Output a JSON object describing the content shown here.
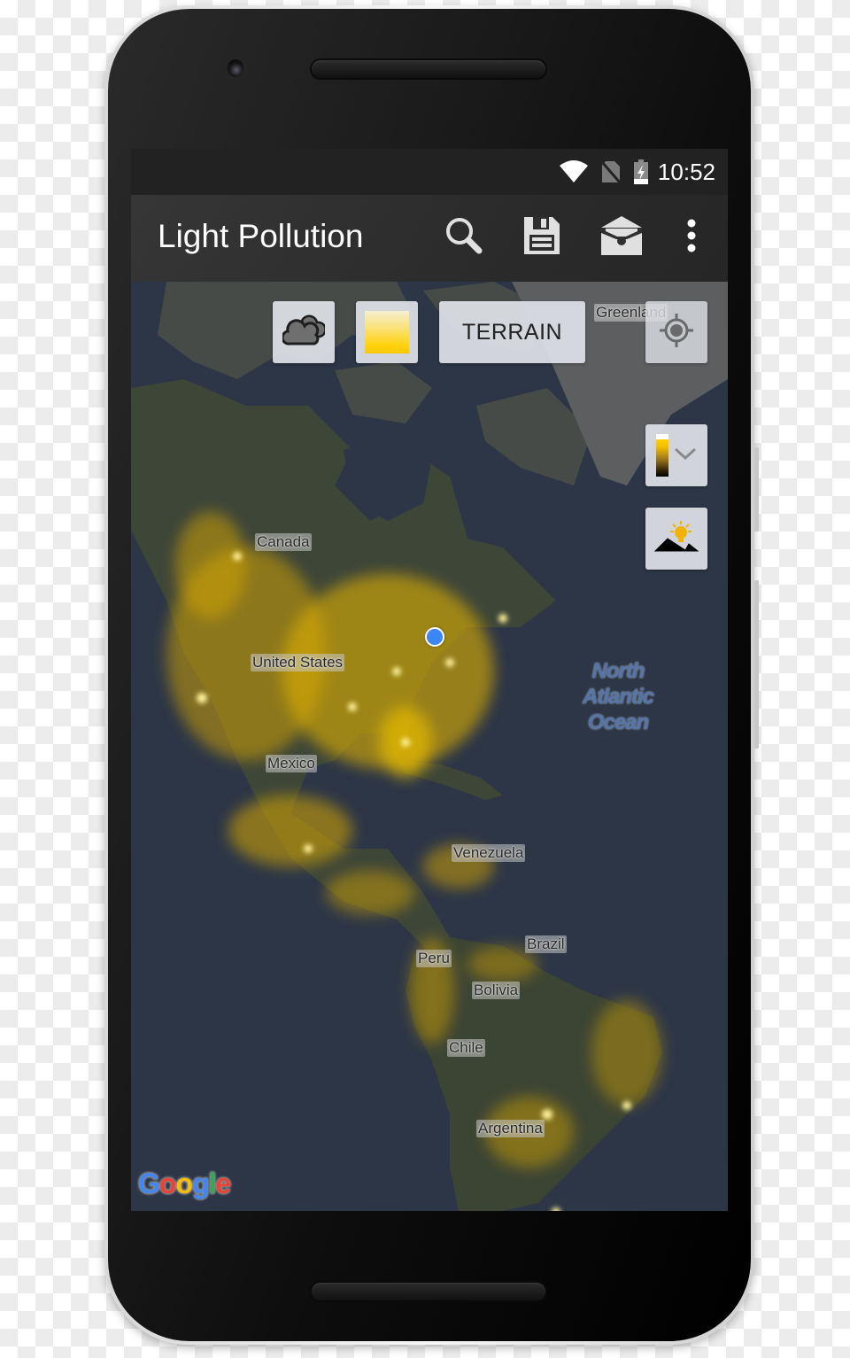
{
  "status_bar": {
    "time": "10:52",
    "icons": [
      "wifi-icon",
      "no-sim-icon",
      "battery-charging-icon"
    ]
  },
  "app_bar": {
    "title": "Light Pollution",
    "actions": [
      {
        "name": "search",
        "icon": "search-icon"
      },
      {
        "name": "save",
        "icon": "save-icon"
      },
      {
        "name": "toolbox",
        "icon": "toolbox-icon"
      },
      {
        "name": "more",
        "icon": "more-vert-icon"
      }
    ]
  },
  "map_controls": {
    "clouds_button": {
      "icon": "cloud-icon"
    },
    "overlay_button": {
      "icon": "overlay-gradient-icon"
    },
    "map_type_button": {
      "label": "TERRAIN"
    },
    "my_location_button": {
      "icon": "crosshair-icon"
    },
    "legend_button": {
      "icon": "light-scale-legend-icon",
      "expand_icon": "chevron-down-icon"
    },
    "horizon_button": {
      "icon": "sunrise-landscape-icon"
    }
  },
  "map": {
    "attribution": "Google",
    "google_colors": [
      "#4285f4",
      "#ea4335",
      "#fbbc05",
      "#4285f4",
      "#34a853",
      "#ea4335"
    ],
    "glow_color": "#ffd21a",
    "location_dot_color": "#3d86f5",
    "labels": {
      "greenland": "Greenland",
      "canada": "Canada",
      "united_states": "United States",
      "mexico": "Mexico",
      "venezuela": "Venezuela",
      "brazil": "Brazil",
      "peru": "Peru",
      "bolivia": "Bolivia",
      "chile": "Chile",
      "argentina": "Argentina"
    },
    "ocean_label": {
      "line1": "North",
      "line2": "Atlantic",
      "line3": "Ocean"
    }
  }
}
